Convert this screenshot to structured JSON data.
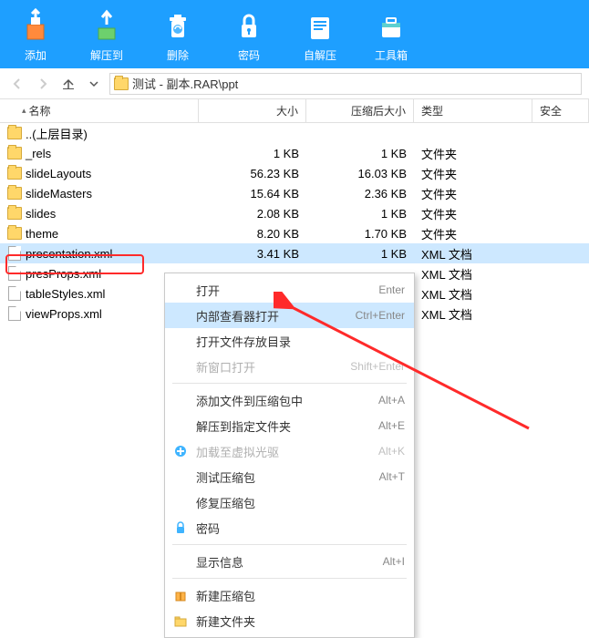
{
  "toolbar": [
    {
      "label": "添加",
      "icon": "add"
    },
    {
      "label": "解压到",
      "icon": "extract"
    },
    {
      "label": "删除",
      "icon": "delete"
    },
    {
      "label": "密码",
      "icon": "password"
    },
    {
      "label": "自解压",
      "icon": "sfx"
    },
    {
      "label": "工具箱",
      "icon": "toolbox"
    }
  ],
  "path": "测试 - 副本.RAR\\ppt",
  "columns": {
    "name": "名称",
    "size": "大小",
    "csize": "压缩后大小",
    "type": "类型",
    "safe": "安全"
  },
  "rows": [
    {
      "name": "..(上层目录)",
      "icon": "folder",
      "size": "",
      "csize": "",
      "type": ""
    },
    {
      "name": "_rels",
      "icon": "folder",
      "size": "1 KB",
      "csize": "1 KB",
      "type": "文件夹"
    },
    {
      "name": "slideLayouts",
      "icon": "folder",
      "size": "56.23 KB",
      "csize": "16.03 KB",
      "type": "文件夹"
    },
    {
      "name": "slideMasters",
      "icon": "folder",
      "size": "15.64 KB",
      "csize": "2.36 KB",
      "type": "文件夹"
    },
    {
      "name": "slides",
      "icon": "folder",
      "size": "2.08 KB",
      "csize": "1 KB",
      "type": "文件夹"
    },
    {
      "name": "theme",
      "icon": "folder",
      "size": "8.20 KB",
      "csize": "1.70 KB",
      "type": "文件夹"
    },
    {
      "name": "presentation.xml",
      "icon": "file",
      "size": "3.41 KB",
      "csize": "1 KB",
      "type": "XML 文档",
      "selected": true
    },
    {
      "name": "presProps.xml",
      "icon": "file",
      "size": "",
      "csize": "",
      "type": "XML 文档"
    },
    {
      "name": "tableStyles.xml",
      "icon": "file",
      "size": "",
      "csize": "",
      "type": "XML 文档"
    },
    {
      "name": "viewProps.xml",
      "icon": "file",
      "size": "",
      "csize": "",
      "type": "XML 文档"
    }
  ],
  "menu": [
    {
      "label": "打开",
      "short": "Enter"
    },
    {
      "label": "内部查看器打开",
      "short": "Ctrl+Enter",
      "hover": true
    },
    {
      "label": "打开文件存放目录"
    },
    {
      "label": "新窗口打开",
      "short": "Shift+Enter",
      "disabled": true
    },
    {
      "sep": true
    },
    {
      "label": "添加文件到压缩包中",
      "short": "Alt+A"
    },
    {
      "label": "解压到指定文件夹",
      "short": "Alt+E"
    },
    {
      "label": "加载至虚拟光驱",
      "short": "Alt+K",
      "disabled": true,
      "icon": "plus"
    },
    {
      "label": "测试压缩包",
      "short": "Alt+T"
    },
    {
      "label": "修复压缩包"
    },
    {
      "label": "密码",
      "icon": "lock"
    },
    {
      "sep": true
    },
    {
      "label": "显示信息",
      "short": "Alt+I"
    },
    {
      "sep": true
    },
    {
      "label": "新建压缩包",
      "icon": "newzip"
    },
    {
      "label": "新建文件夹",
      "icon": "newfolder"
    }
  ]
}
